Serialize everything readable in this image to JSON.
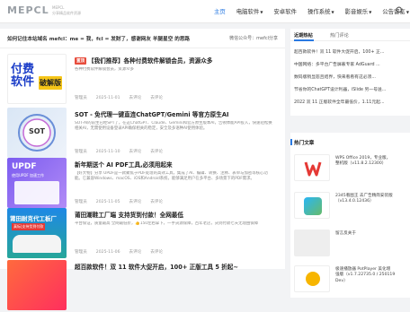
{
  "header": {
    "logo": "MEPCL",
    "logo_sub_1": "MEPCL",
    "logo_sub_2": "分享精品软件资源",
    "nav": [
      {
        "label": "主页",
        "active": true,
        "caret": false
      },
      {
        "label": "电脑软件",
        "active": false,
        "caret": true
      },
      {
        "label": "安卓软件",
        "active": false,
        "caret": false
      },
      {
        "label": "操作系统",
        "active": false,
        "caret": true
      },
      {
        "label": "影音娱乐",
        "active": false,
        "caret": true
      },
      {
        "label": "公告留言",
        "active": false,
        "caret": true
      }
    ]
  },
  "notice": {
    "text": "如何记住本站域名 mefcl：me = 我，fcl = 发财了，感谢网友 羊腿星空 的思路",
    "wechat": "微信公众号：mefcl分享"
  },
  "posts": [
    {
      "hot": "置顶",
      "title": "【我们推荐】各种付费软件解锁会员，资源众多",
      "excerpt": "各种付费软件解锁会员，资源众多",
      "thumb_line1": "付费",
      "thumb_line2": "软件",
      "thumb_badge": "破解版",
      "author": "管理员",
      "date": "2025-11-01",
      "comments": "去评论",
      "views": "去评论"
    },
    {
      "hot": "",
      "title": "SOT - 免代理一键直连ChatGPT/Gemini 等官方原生AI",
      "excerpt": "SOT-AI的前生已经SPT了，在这ChatGPT、Claude、Gemini和官方原生版本AI，告顿体能API投入，快速轻松换相关AI，无需使用设备登录API确保相关的稳定，安全及多语种AI使用体验。",
      "thumb_text": "SOT",
      "author": "管理员",
      "date": "2025-11-10",
      "comments": "去评论",
      "views": "去评论"
    },
    {
      "hot": "",
      "title": "新年期送个 AI PDF工具,必须用起来",
      "excerpt": "【好大物】分享 UPDF是一款聚焦于PDF处理的高效工具，集成了AI、编辑、转换、注释、表单与加密等核心功能。它兼容Windows、macOS、iOS和Android系统，能够满足用户在多平台、多场景下的PDF需求。",
      "thumb_text": "UPDF",
      "thumb_sub": "使用UPDF 加速工作",
      "author": "管理员",
      "date": "2025-11-05",
      "comments": "去评论",
      "views": "去评论"
    },
    {
      "hot": "",
      "title": "莆田潮鞋工厂端 支持货到付款！全网最低",
      "excerpt": "平台保证，质量最高 全网最低价，👍150左右拿下，一手货源保障，百年老店，货到付款七天无理由保障",
      "thumb_text": "莆田耐克代工板厂",
      "thumb_sub": "真标|支持货到付款",
      "author": "管理员",
      "date": "2025-11-06",
      "comments": "去评论",
      "views": "去评论"
    },
    {
      "hot": "",
      "title": "超百款软件！双 11 软件大促开启，100+ 正版工具 5 折起~",
      "excerpt": "",
      "author": "管理员",
      "date": "2025-11-08",
      "comments": "去评论",
      "views": "去评论"
    }
  ],
  "sidebar": {
    "tabs": [
      "近期热帖",
      "热门评论"
    ],
    "tab_items": [
      "超百款软件！双 11 软件大促开启，100+ 正...",
      "中国网络：多平台广告屏蔽专家 AdGuard ...",
      "数码版稍显悲且结界，快来看看有这必须...",
      "节省你的ChatGPT设计利器，iSlide 另一号送...",
      "2022 双 11 正版软件全年最低价，1.11元起..."
    ],
    "hot_title": "热门文章",
    "hot_items": [
      {
        "text": "WPS Office 2019，专业版，\n整机版（v11.8.2.12300）",
        "color": "#ffffff"
      },
      {
        "text": "2345看图王 去广告精简安装版\n（v13.4.0.12436）",
        "color": "#ffffff"
      },
      {
        "text": "留言反关于",
        "color": "#dddddd"
      },
      {
        "text": "极速播放器 PotPlayer 美化增\n强版（v1.7.22735.0 / 250119\nDev）",
        "color": "#ffffff"
      }
    ]
  },
  "colors": {
    "accent": "#2a7ae2",
    "hot": "#e74c3c"
  }
}
